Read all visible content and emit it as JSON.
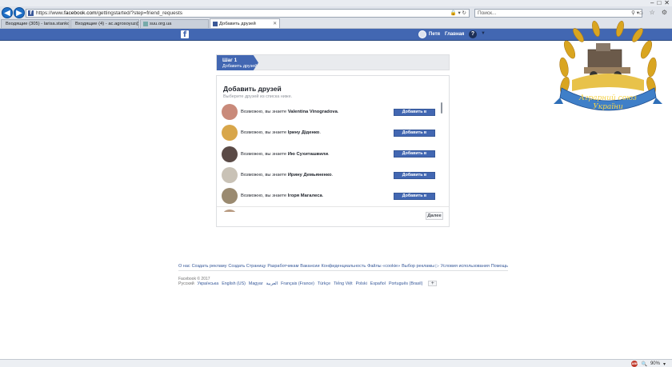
{
  "browser": {
    "url_prefix": "https://www.",
    "url_domain": "facebook.com",
    "url_path": "/gettingstarted/?step=friend_requests",
    "search_placeholder": "Поиск...",
    "tabs": [
      {
        "label": "Входящие (305) - larisa.stanko...",
        "active": false
      },
      {
        "label": "Входящие (4) - ac.agrosoyuz@g...",
        "active": false
      },
      {
        "label": "suu.org.ua",
        "active": false
      },
      {
        "label": "Добавить друзей",
        "active": true
      }
    ],
    "zoom": "90%"
  },
  "fb_header": {
    "user_name": "Петя",
    "home_label": "Главная",
    "help_symbol": "?"
  },
  "step": {
    "number": "Шаг 1",
    "title": "Добавить друзей"
  },
  "panel": {
    "title": "Добавить друзей",
    "subtitle": "Выберите друзей из списка ниже.",
    "next_label": "Далее",
    "add_label": "Добавить в друзья",
    "prefix": "Возможно, вы знаете",
    "suggestions": [
      {
        "name": "Valentina Vinogradova",
        "avatar_color": "#c98a7a"
      },
      {
        "name": "Ірину Діденко",
        "avatar_color": "#d8a64a"
      },
      {
        "name": "Ию Сухиташвили",
        "avatar_color": "#5a4a46"
      },
      {
        "name": "Ирину Демьяненко",
        "avatar_color": "#c9c2b6"
      },
      {
        "name": "Ігоря Магалеса",
        "avatar_color": "#9a8a70"
      }
    ]
  },
  "footer": {
    "links": [
      "О нас",
      "Создать рекламу",
      "Создать Страницу",
      "Разработчикам",
      "Вакансии",
      "Конфиденциальность",
      "Файлы «cookie»",
      "Выбор рекламы",
      "Условия использования",
      "Помощь"
    ],
    "copyright": "Facebook © 2017",
    "languages": [
      "Русский",
      "Українська",
      "English (US)",
      "Magyar",
      "العربية",
      "Français (France)",
      "Türkçe",
      "Tiếng Việt",
      "Polski",
      "Español",
      "Português (Brasil)"
    ]
  },
  "logo": {
    "text_line1": "Аграрний союз",
    "text_line2": "України"
  }
}
